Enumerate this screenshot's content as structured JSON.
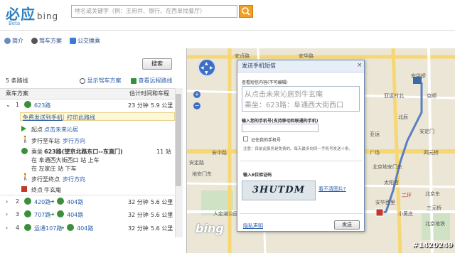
{
  "header": {
    "logo_text": "必应",
    "logo_sub": "bing",
    "beta": "Beta",
    "search_placeholder": "地名或关键字（例：王府井、银行、在西单找餐厅）"
  },
  "tabs": [
    {
      "label": "简介"
    },
    {
      "label": "驾车方案"
    },
    {
      "label": "公交换乘"
    }
  ],
  "left": {
    "search_button": "搜索",
    "route_count": "5 条路线",
    "show_driving": "显示驾车方案",
    "view_distant": "查看远程路线",
    "col_plan": "乘车方案",
    "col_time": "估计时间和车程",
    "route1": {
      "num": "1",
      "name": "623路",
      "time": "23 分钟",
      "dist": "5.9 公里"
    },
    "send_to_phone": "免费发送到手机",
    "print_route": "打印此路线",
    "start_label": "起点",
    "start_hint": "点击未来沁居",
    "walk_to_stop": "步行至车站",
    "walk_dir": "步行方向",
    "ride_prefix": "乘坐",
    "ride_bus": "623路(望京北路东口--东直门)",
    "ride_stops": "11 站",
    "board_at": "在 阜通西大街西口 站 上车",
    "alight_at": "在 左家庄 站 下车",
    "walk_to_end": "步行至终点",
    "walk_dir2": "步行方向",
    "end_label": "终点",
    "end_name": "牛玄庵",
    "other_routes": [
      {
        "num": "2",
        "a": "420路",
        "b": "404路",
        "time": "32 分钟",
        "dist": "5.6 公里"
      },
      {
        "num": "3",
        "a": "707路",
        "b": "404路",
        "time": "32 分钟",
        "dist": "5.6 公里"
      },
      {
        "num": "4",
        "a": "运通107路",
        "b": "404路",
        "time": "32 分钟",
        "dist": "5.6 公里"
      }
    ]
  },
  "map": {
    "labels": [
      "安中路",
      "安贞路",
      "安定路",
      "安华路",
      "亚运村北",
      "北辰",
      "安华桥",
      "二环",
      "安定门",
      "小黄庄",
      "北京东",
      "安华西里",
      "北京地安门东",
      "地安门东",
      "四元桥",
      "京顺",
      "三元桥",
      "太阳宫",
      "北京地铁",
      "人定湖公园",
      "亚运",
      "广场"
    ],
    "watermark": "#1420249",
    "bing": "bing"
  },
  "dialog": {
    "title": "发送手机短信",
    "preview_label": "查看短信内容(不可编辑)",
    "msg_line1": "从点击未来沁居到牛玄庵",
    "msg_line2": "乘坐：623路：阜通西大街西口",
    "phone_label": "输入您的手机号(支持移动和联通的手机)",
    "remember": "记住我的手机号",
    "note": "注意：目前此服务是免费的。每天最多向同一手机号发送十条。",
    "captcha_label": "输入6位验证码",
    "captcha_text": "3HUTDM",
    "refresh": "看不清图片?",
    "privacy": "隐私声明",
    "send": "发送"
  },
  "colors": {
    "accent": "#2b5fa8",
    "route_green": "#3b8f3b",
    "search_orange": "#f0a028"
  }
}
